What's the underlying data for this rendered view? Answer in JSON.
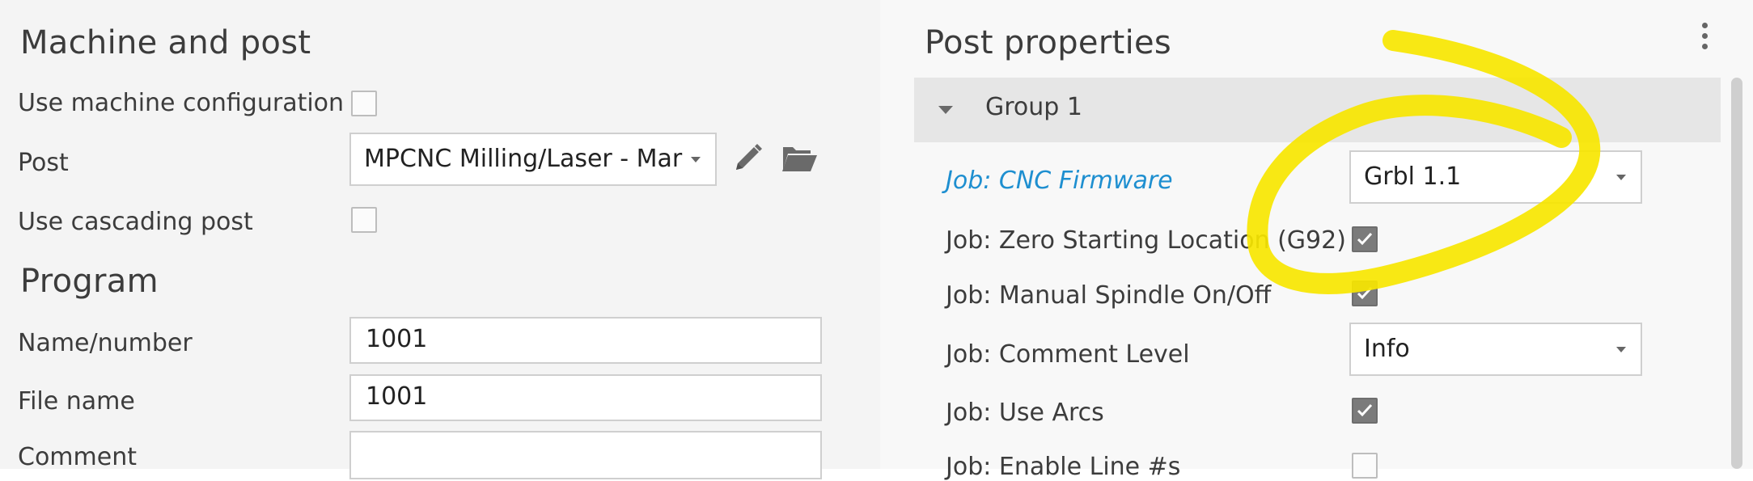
{
  "machine": {
    "title": "Machine and post",
    "use_machine_config_label": "Use machine configuration",
    "post_label": "Post",
    "post_value": "MPCNC Milling/Laser - Mar",
    "use_cascading_label": "Use cascading post"
  },
  "program": {
    "title": "Program",
    "name_label": "Name/number",
    "name_value": "1001",
    "file_label": "File name",
    "file_value": "1001",
    "comment_label": "Comment",
    "comment_value": ""
  },
  "post_properties": {
    "title": "Post properties",
    "group_label": "Group 1",
    "props": [
      {
        "label": "Job: CNC Firmware",
        "type": "dropdown",
        "value": "Grbl 1.1",
        "highlight": true
      },
      {
        "label": "Job: Zero Starting Location (G92)",
        "type": "checkbox",
        "checked": true
      },
      {
        "label": "Job: Manual Spindle On/Off",
        "type": "checkbox",
        "checked": true
      },
      {
        "label": "Job: Comment Level",
        "type": "dropdown",
        "value": "Info"
      },
      {
        "label": "Job: Use Arcs",
        "type": "checkbox",
        "checked": true
      },
      {
        "label": "Job: Enable Line #s",
        "type": "checkbox",
        "checked": false
      }
    ]
  },
  "colors": {
    "link_blue": "#1e8fd0",
    "annotation_yellow": "#f7e600",
    "checked_box": "#7b7b7b"
  },
  "icons": {
    "edit": "pencil-icon",
    "open": "folder-open-icon",
    "more": "kebab-menu-icon"
  }
}
